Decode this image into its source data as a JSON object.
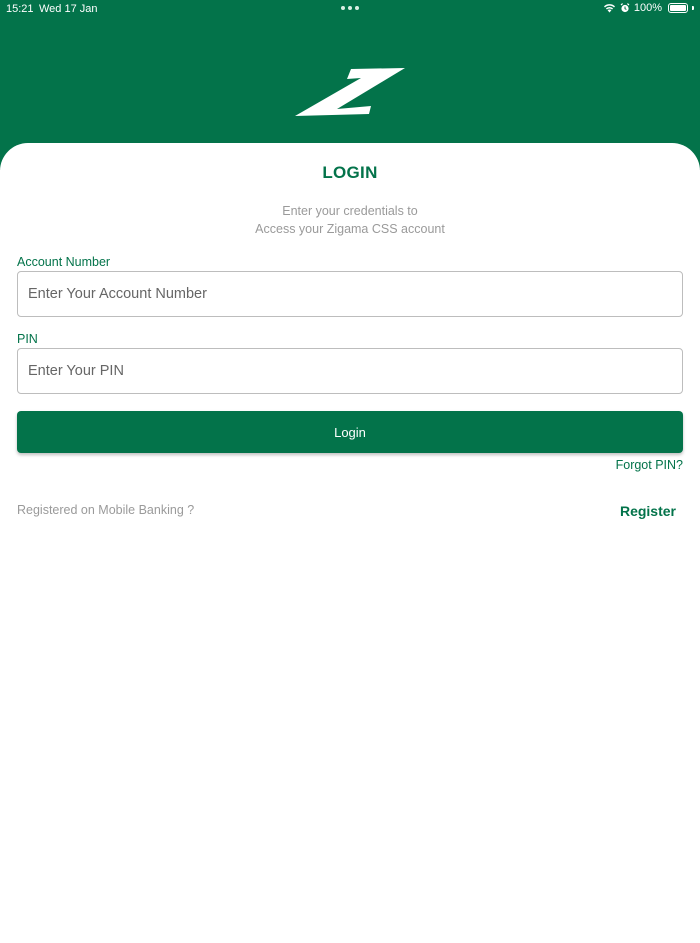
{
  "status_bar": {
    "time": "15:21",
    "date": "Wed 17 Jan",
    "battery": "100%",
    "icons": [
      "wifi-icon",
      "alarm-icon",
      "battery-icon"
    ]
  },
  "colors": {
    "brand": "#03734a",
    "muted_text": "#9a9a9a",
    "input_border": "#bdbdbd"
  },
  "login": {
    "title": "LOGIN",
    "subtitle_line1": "Enter your credentials to",
    "subtitle_line2": "Access your Zigama CSS account",
    "account_label": "Account Number",
    "account_placeholder": "Enter Your Account Number",
    "account_value": "",
    "pin_label": "PIN",
    "pin_placeholder": "Enter Your PIN",
    "pin_value": "",
    "login_button": "Login",
    "forgot_pin": "Forgot PIN?",
    "registered_prompt": "Registered on Mobile Banking ?",
    "register_link": "Register"
  }
}
